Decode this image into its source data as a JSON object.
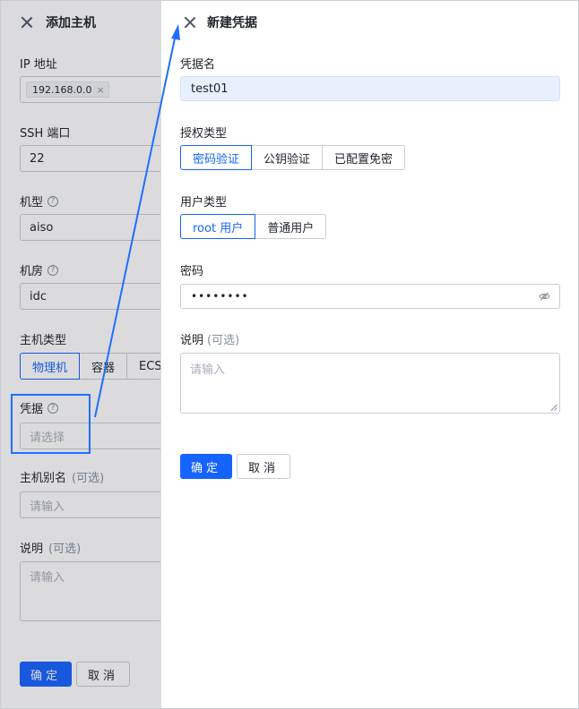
{
  "background_drawer": {
    "title": "添加主机",
    "ip": {
      "label": "IP 地址",
      "tag": "192.168.0.0",
      "tag_close": "×"
    },
    "ssh": {
      "label": "SSH 端口",
      "value": "22"
    },
    "model": {
      "label": "机型",
      "value": "aiso",
      "help": "?"
    },
    "room": {
      "label": "机房",
      "value": "idc",
      "help": "?"
    },
    "host_type": {
      "label": "主机类型",
      "options": [
        "物理机",
        "容器",
        "ECS"
      ],
      "selected": "物理机"
    },
    "credential": {
      "label": "凭据",
      "placeholder": "请选择",
      "help": "?"
    },
    "alias": {
      "label": "主机别名",
      "optional": "(可选)",
      "placeholder": "请输入"
    },
    "desc": {
      "label": "说明",
      "optional": "(可选)",
      "placeholder": "请输入"
    },
    "confirm_label": "确定",
    "cancel_label": "取消"
  },
  "foreground_drawer": {
    "title": "新建凭据",
    "name": {
      "label": "凭据名",
      "value": "test01"
    },
    "auth_type": {
      "label": "授权类型",
      "options": [
        "密码验证",
        "公钥验证",
        "已配置免密"
      ],
      "selected": "密码验证"
    },
    "user_type": {
      "label": "用户类型",
      "options": [
        "root 用户",
        "普通用户"
      ],
      "selected": "root 用户"
    },
    "password": {
      "label": "密码",
      "value": "••••••••"
    },
    "desc": {
      "label": "说明",
      "optional": "(可选)",
      "placeholder": "请输入"
    },
    "confirm_label": "确定",
    "cancel_label": "取消"
  },
  "colors": {
    "primary": "#1664ff",
    "annotation": "#1f6fff",
    "border": "#c9cdd4",
    "placeholder": "#a9aeb8",
    "autofill": "#e8f0fe"
  },
  "icons": [
    "close-icon",
    "help-icon",
    "eye-off-icon",
    "tag-close-icon",
    "annotation-arrow"
  ]
}
